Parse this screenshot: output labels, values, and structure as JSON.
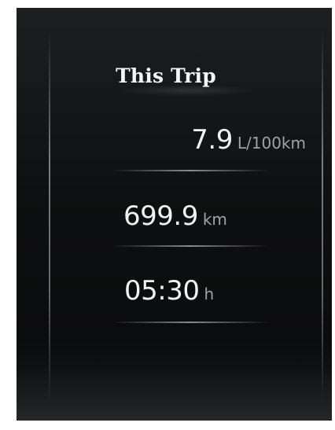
{
  "screen": {
    "title": "This Trip",
    "stats": [
      {
        "value": "7.9",
        "unit": "L/100km"
      },
      {
        "value": "699.9",
        "unit": "km"
      },
      {
        "value": "05:30",
        "unit": "h"
      }
    ]
  },
  "colors": {
    "background": "#0f1011",
    "text": "#f2f2f2",
    "unit": "#9ea2a7",
    "divider": "#afb4ba"
  }
}
